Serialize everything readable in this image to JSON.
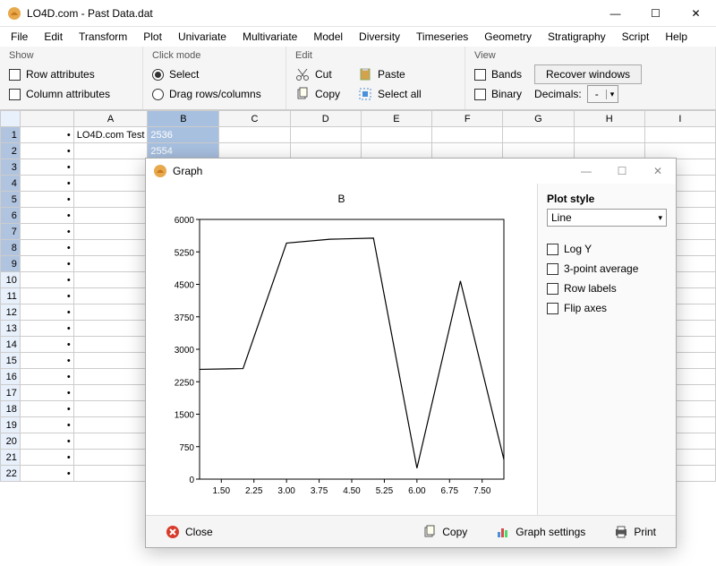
{
  "window": {
    "title": "LO4D.com - Past Data.dat",
    "sys": {
      "min": "—",
      "max": "☐",
      "close": "✕"
    }
  },
  "menu": [
    "File",
    "Edit",
    "Transform",
    "Plot",
    "Univariate",
    "Multivariate",
    "Model",
    "Diversity",
    "Timeseries",
    "Geometry",
    "Stratigraphy",
    "Script",
    "Help"
  ],
  "ribbon": {
    "show": {
      "title": "Show",
      "row_attr": "Row attributes",
      "col_attr": "Column attributes"
    },
    "click": {
      "title": "Click mode",
      "select": "Select",
      "drag": "Drag rows/columns"
    },
    "edit": {
      "title": "Edit",
      "cut": "Cut",
      "copy": "Copy",
      "paste": "Paste",
      "select_all": "Select all"
    },
    "view": {
      "title": "View",
      "bands": "Bands",
      "binary": "Binary",
      "recover": "Recover windows",
      "decimals_label": "Decimals:",
      "decimals_value": "-"
    }
  },
  "sheet": {
    "cols": [
      "A",
      "B",
      "C",
      "D",
      "E",
      "F",
      "G",
      "H",
      "I"
    ],
    "a1": "LO4D.com Test",
    "bvals": [
      "2536",
      "2554",
      "5454",
      "5542",
      "5568",
      "253",
      "4577",
      "454"
    ],
    "rows_total": 22
  },
  "graph": {
    "title": "Graph",
    "chart_title": "B",
    "sys": {
      "min": "—",
      "max": "☐",
      "close": "✕"
    },
    "plotstyle_label": "Plot style",
    "plotstyle_value": "Line",
    "opts": {
      "logy": "Log Y",
      "avg3": "3-point average",
      "rowlabels": "Row labels",
      "flip": "Flip axes"
    },
    "footer": {
      "close": "Close",
      "copy": "Copy",
      "settings": "Graph settings",
      "print": "Print"
    }
  },
  "chart_data": {
    "type": "line",
    "title": "B",
    "xlabel": "",
    "ylabel": "",
    "x": [
      1,
      2,
      3,
      4,
      5,
      6,
      7,
      8
    ],
    "values": [
      2536,
      2554,
      5454,
      5542,
      5568,
      253,
      4577,
      454
    ],
    "ylim": [
      0,
      6000
    ],
    "yticks": [
      0,
      750,
      1500,
      2250,
      3000,
      3750,
      4500,
      5250,
      6000
    ],
    "xticks": [
      1.5,
      2.25,
      3.0,
      3.75,
      4.5,
      5.25,
      6.0,
      6.75,
      7.5
    ]
  }
}
